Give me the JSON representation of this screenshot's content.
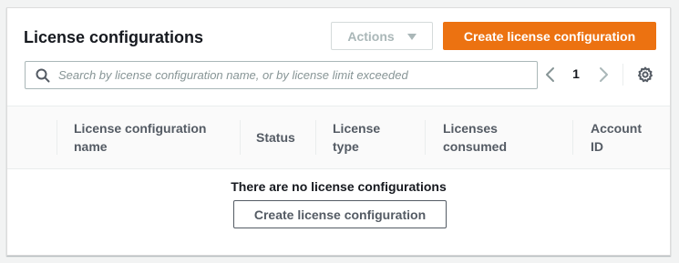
{
  "panel": {
    "title": "License configurations"
  },
  "toolbar": {
    "actions_label": "Actions",
    "create_label": "Create license configuration"
  },
  "search": {
    "placeholder": "Search by license configuration name, or by license limit exceeded",
    "value": "",
    "icon": "search-icon"
  },
  "pagination": {
    "current_page": "1",
    "prev_icon": "chevron-left-icon",
    "next_icon": "chevron-right-icon",
    "settings_icon": "gear-icon"
  },
  "table": {
    "columns": [
      {
        "label": "License configuration name"
      },
      {
        "label": "Status"
      },
      {
        "label": "License type"
      },
      {
        "label": "Licenses consumed"
      },
      {
        "label": "Account ID"
      }
    ],
    "rows": []
  },
  "empty_state": {
    "message": "There are no license configurations",
    "button_label": "Create license configuration"
  },
  "colors": {
    "primary": "#ec7211",
    "disabled": "#aab7b8",
    "text": "#16191f",
    "header_text": "#545b64"
  }
}
